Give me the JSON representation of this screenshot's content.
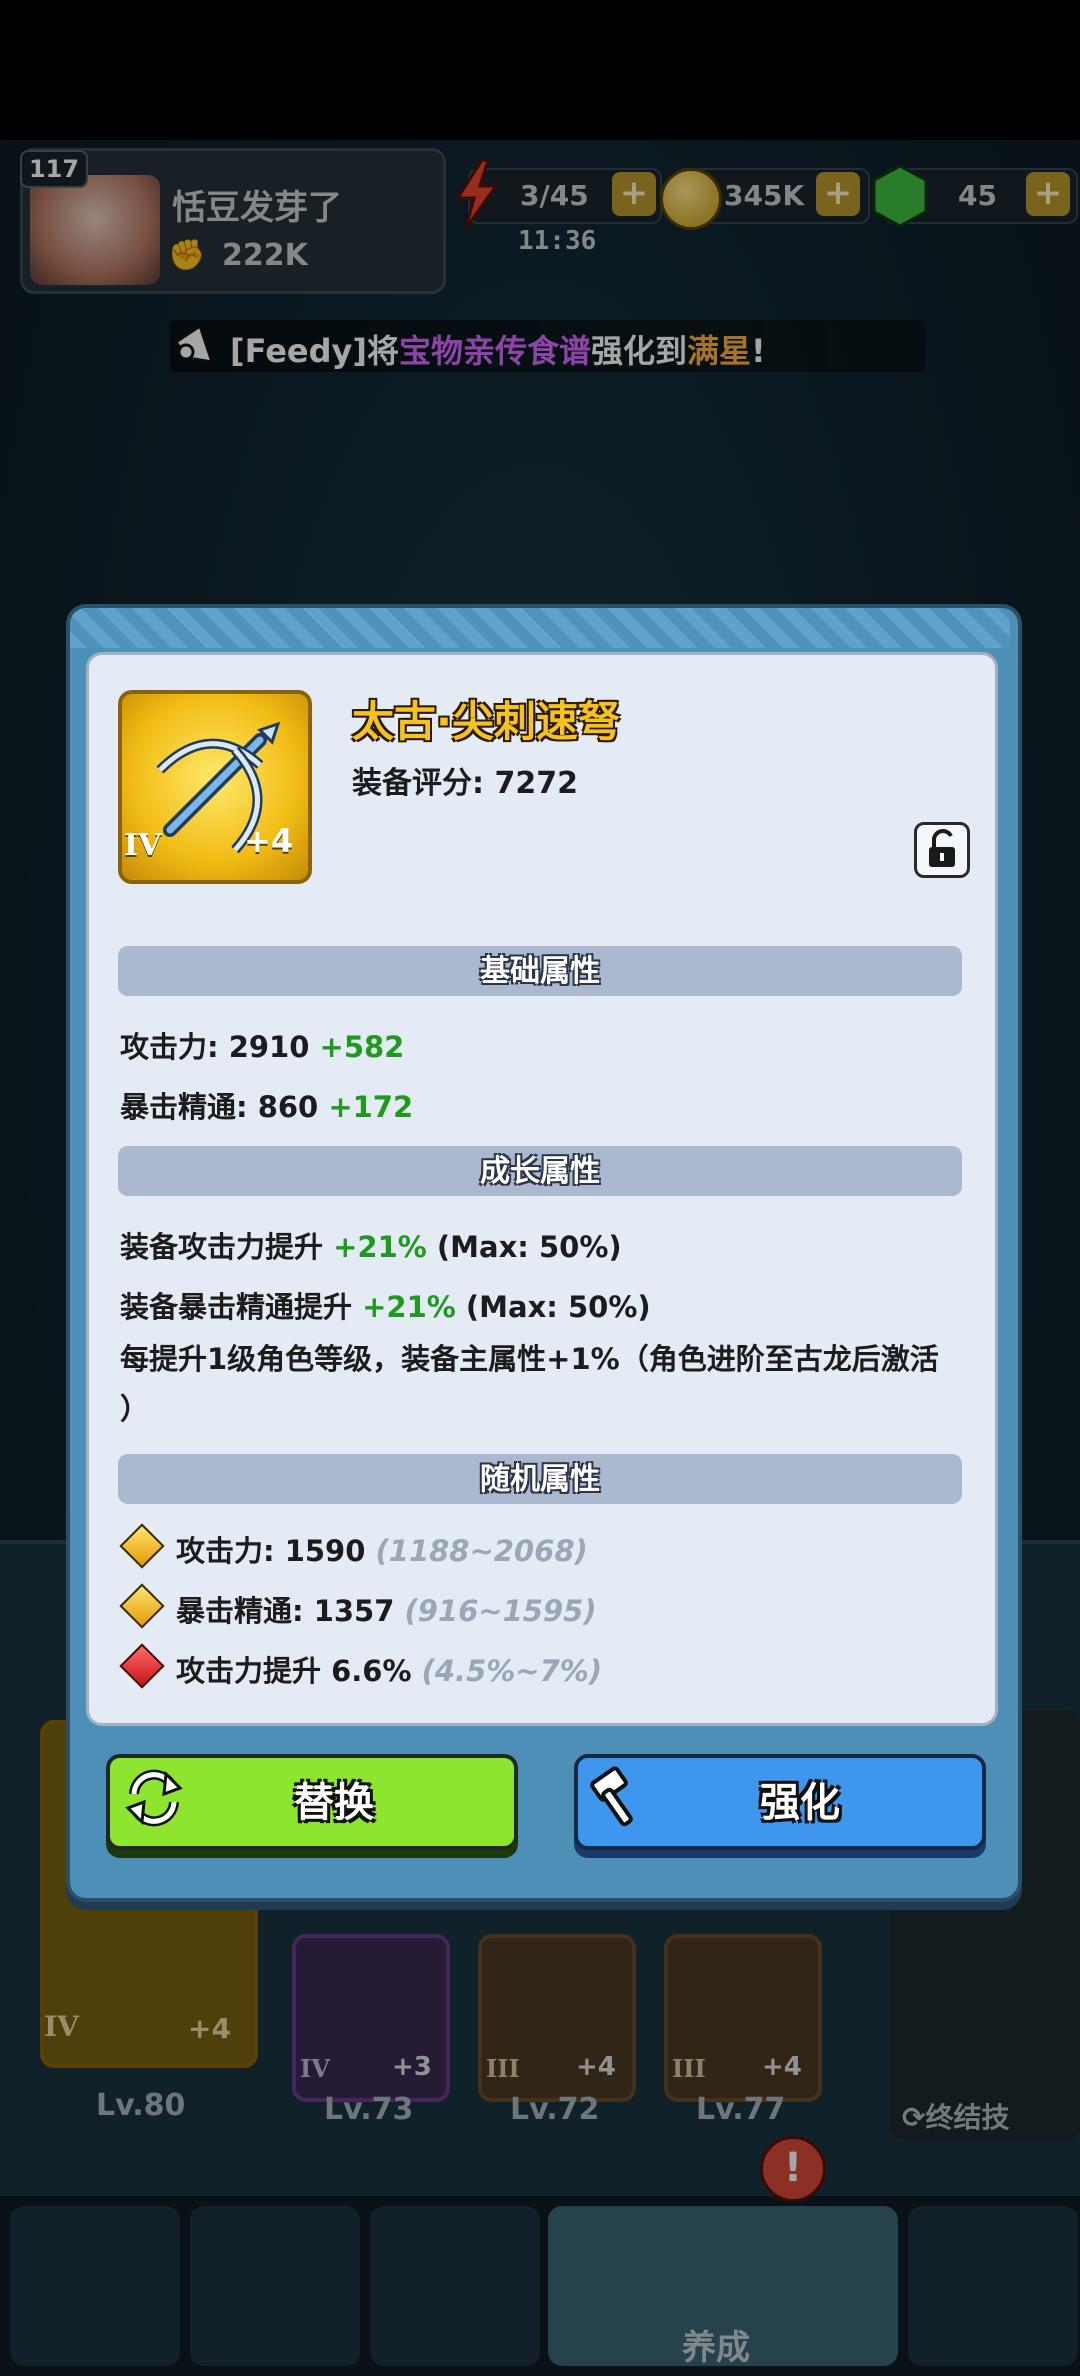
{
  "player": {
    "level": "117",
    "name": "恬豆发芽了",
    "power": "222K"
  },
  "resources": {
    "energy": "3/45",
    "energy_timer": "11:36",
    "gold": "345K",
    "gems": "45",
    "plus": "+"
  },
  "broadcast": {
    "prefix": "[Feedy]将",
    "item": "宝物亲传食谱",
    "middle": "强化到",
    "level": "满星",
    "suffix": "!"
  },
  "item": {
    "name": "太古·尖刺速弩",
    "score_label": "装备评分: 7272",
    "tier": "IV",
    "plus": "+4"
  },
  "sections": {
    "base": "基础属性",
    "growth": "成长属性",
    "random": "随机属性"
  },
  "base_attrs": [
    {
      "label": "攻击力:  2910 ",
      "bonus": "+582"
    },
    {
      "label": "暴击精通:  860 ",
      "bonus": "+172"
    }
  ],
  "growth_attrs": [
    {
      "label": "装备攻击力提升 ",
      "bonus": "+21%",
      "max": " (Max: 50%)"
    },
    {
      "label": "装备暴击精通提升 ",
      "bonus": "+21%",
      "max": " (Max: 50%)"
    }
  ],
  "growth_note_line1": "每提升1级角色等级，装备主属性+1%（角色进阶至古龙后激活",
  "growth_note_line2": "）",
  "random_attrs": [
    {
      "label": "攻击力: 1590 ",
      "range": "(1188~2068)",
      "gem": "gold"
    },
    {
      "label": "暴击精通: 1357 ",
      "range": "(916~1595)",
      "gem": "gold"
    },
    {
      "label": "攻击力提升 6.6% ",
      "range": "(4.5%~7%)",
      "gem": "red"
    }
  ],
  "buttons": {
    "replace": "替换",
    "enhance": "强化"
  },
  "background": {
    "slots": [
      {
        "tier": "IV",
        "plus": "+4",
        "level": "Lv.80"
      },
      {
        "tier": "IV",
        "plus": "+3",
        "level": "Lv.73"
      },
      {
        "tier": "III",
        "plus": "+4",
        "level": "Lv.72"
      },
      {
        "tier": "III",
        "plus": "+4",
        "level": "Lv.77"
      }
    ],
    "ultimate_label": "终结技",
    "nav_active_label": "养成"
  },
  "colors": {
    "modal_frame": "#4e8fb8",
    "modal_body": "#e4ebf4",
    "bonus_green": "#1f9a1f",
    "item_name_gold": "#f5c321",
    "replace_button": "#8ee52f",
    "enhance_button": "#3e97ec"
  }
}
